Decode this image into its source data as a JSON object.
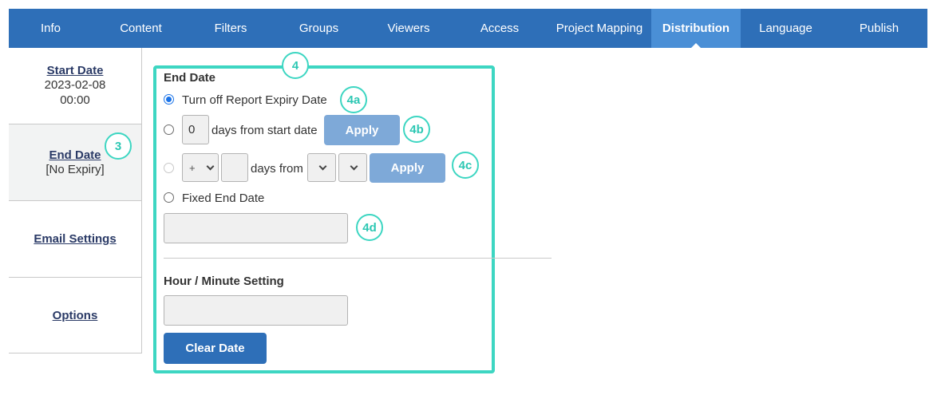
{
  "nav": {
    "tabs": [
      {
        "label": "Info"
      },
      {
        "label": "Content"
      },
      {
        "label": "Filters"
      },
      {
        "label": "Groups"
      },
      {
        "label": "Viewers"
      },
      {
        "label": "Access"
      },
      {
        "label": "Project Mapping"
      },
      {
        "label": "Distribution"
      },
      {
        "label": "Language"
      },
      {
        "label": "Publish"
      }
    ],
    "active_tab": "Distribution"
  },
  "sidebar": {
    "start_date": {
      "label": "Start Date",
      "value_date": "2023-02-08",
      "value_time": "00:00"
    },
    "end_date": {
      "label": "End Date",
      "value": "[No Expiry]"
    },
    "email_settings": {
      "label": "Email Settings"
    },
    "options": {
      "label": "Options"
    }
  },
  "annotations": {
    "a3": "3",
    "a4": "4",
    "a4a": "4a",
    "a4b": "4b",
    "a4c": "4c",
    "a4d": "4d"
  },
  "form": {
    "end_date_heading": "End Date",
    "option_off_label": "Turn off Report Expiry Date",
    "days_value": "0",
    "days_from_start_label": "days from start date",
    "apply_label": "Apply",
    "sign_value": "+",
    "days_from_label": "days from",
    "fixed_end_date_label": "Fixed End Date",
    "fixed_date_value": "",
    "hour_minute_heading": "Hour / Minute Setting",
    "hour_minute_value": "",
    "clear_date_label": "Clear Date"
  },
  "colors": {
    "nav_bg": "#2e6fb8",
    "nav_active": "#4a8fd6",
    "annotation": "#3dd6c2",
    "button_light": "#7ea9d8",
    "button_dark": "#2e6fb8"
  }
}
